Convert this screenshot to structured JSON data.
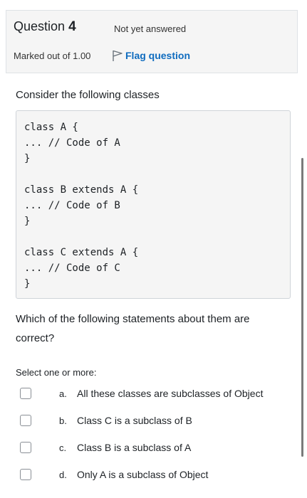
{
  "question": {
    "title_prefix": "Question",
    "number": "4",
    "state": "Not yet answered",
    "grade": "Marked out of 1.00",
    "flag_label": "Flag question"
  },
  "intro": "Consider the following classes",
  "code_blocks": [
    [
      "class A {",
      "... // Code of A",
      "}"
    ],
    [
      "class B extends A {",
      "... // Code of B",
      "}"
    ],
    [
      "class C extends A {",
      "... // Code of C",
      "}"
    ]
  ],
  "question_text": "Which of the following statements about them are correct?",
  "prompt": "Select one or more:",
  "answers": [
    {
      "letter": "a.",
      "text": "All these classes are subclasses of Object",
      "checked": false
    },
    {
      "letter": "b.",
      "text": "Class C is a subclass of B",
      "checked": false
    },
    {
      "letter": "c.",
      "text": "Class B is a subclass of A",
      "checked": false
    },
    {
      "letter": "d.",
      "text": "Only A is a subclass of Object",
      "checked": false
    }
  ],
  "icons": {
    "flag": "flag-outline-icon",
    "checkbox": "checkbox-empty-icon"
  },
  "colors": {
    "link": "#0f6cbf",
    "info_background": "#f5f5f5",
    "code_background": "#f5f5f5"
  }
}
